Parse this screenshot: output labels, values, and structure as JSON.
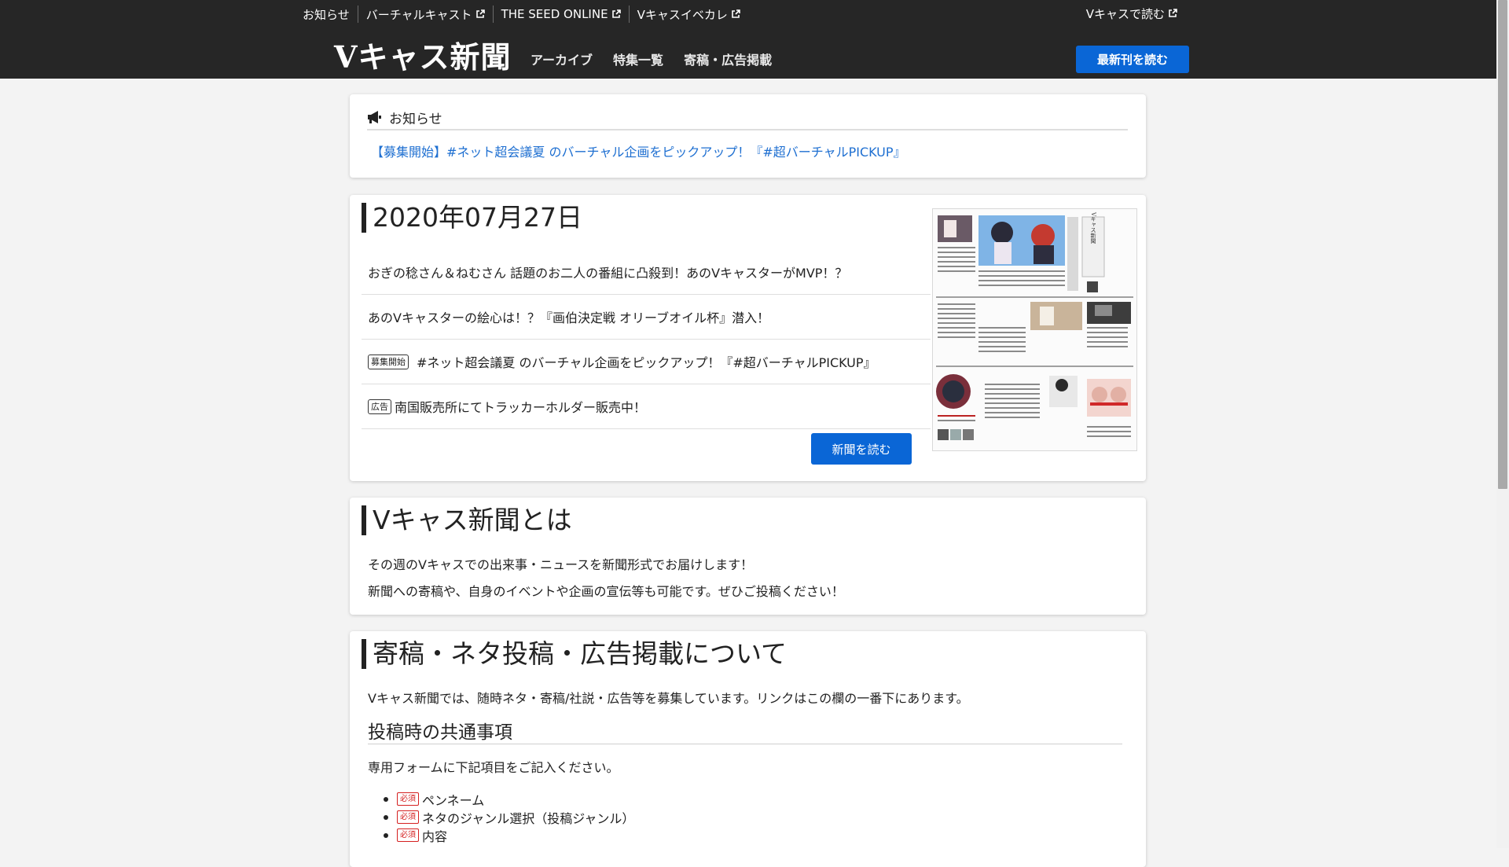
{
  "header": {
    "utility_links": [
      {
        "label": "お知らせ",
        "external": false
      },
      {
        "label": "バーチャルキャスト",
        "external": true
      },
      {
        "label": "THE SEED ONLINE",
        "external": true
      },
      {
        "label": "Vキャスイベカレ",
        "external": true
      }
    ],
    "utility_right": "Vキャスで読む",
    "brand": "Vキャス新聞",
    "nav": [
      "アーカイブ",
      "特集一覧",
      "寄稿・広告掲載"
    ],
    "cta": "最新刊を読む"
  },
  "notice": {
    "heading": "お知らせ",
    "link": "【募集開始】#ネット超会議夏 のバーチャル企画をピックアップ！『#超バーチャルPICKUP』"
  },
  "issue": {
    "date": "2020年07月27日",
    "articles": [
      {
        "tag": "",
        "title": "おぎの稔さん＆ねむさん 話題のお二人の番組に凸殺到！あのVキャスターがMVP！？"
      },
      {
        "tag": "",
        "title": "あのVキャスターの絵心は！？『画伯決定戦 オリーブオイル杯』潜入！"
      },
      {
        "tag": "募集開始",
        "title": "#ネット超会議夏 のバーチャル企画をピックアップ！『#超バーチャルPICKUP』"
      },
      {
        "tag": "広告",
        "title": "南国販売所にてトラッカーホルダー販売中！"
      }
    ],
    "read_button": "新聞を読む",
    "thumbnail_masthead": "Vキャス新聞"
  },
  "about": {
    "title": "Vキャス新聞とは",
    "lines": [
      "その週のVキャスでの出来事・ニュースを新聞形式でお届けします！",
      "新聞への寄稿や、自身のイベントや企画の宣伝等も可能です。ぜひご投稿ください！"
    ]
  },
  "contribute": {
    "title": "寄稿・ネタ投稿・広告掲載について",
    "intro": "Vキャス新聞では、随時ネタ・寄稿/社説・広告等を募集しています。リンクはこの欄の一番下にあります。",
    "subheading": "投稿時の共通事項",
    "form_note": "専用フォームに下記項目をご記入ください。",
    "required_tag": "必須",
    "items": [
      "ペンネーム",
      "ネタのジャンル選択（投稿ジャンル）",
      "内容"
    ]
  },
  "colors": {
    "header_bg": "#262626",
    "accent_blue": "#0a66d6",
    "link_blue": "#1e6fd1",
    "required_red": "#d52020",
    "page_bg": "#f3f3f3"
  },
  "icons": {
    "external": "external-link-icon",
    "notice": "megaphone-icon"
  }
}
